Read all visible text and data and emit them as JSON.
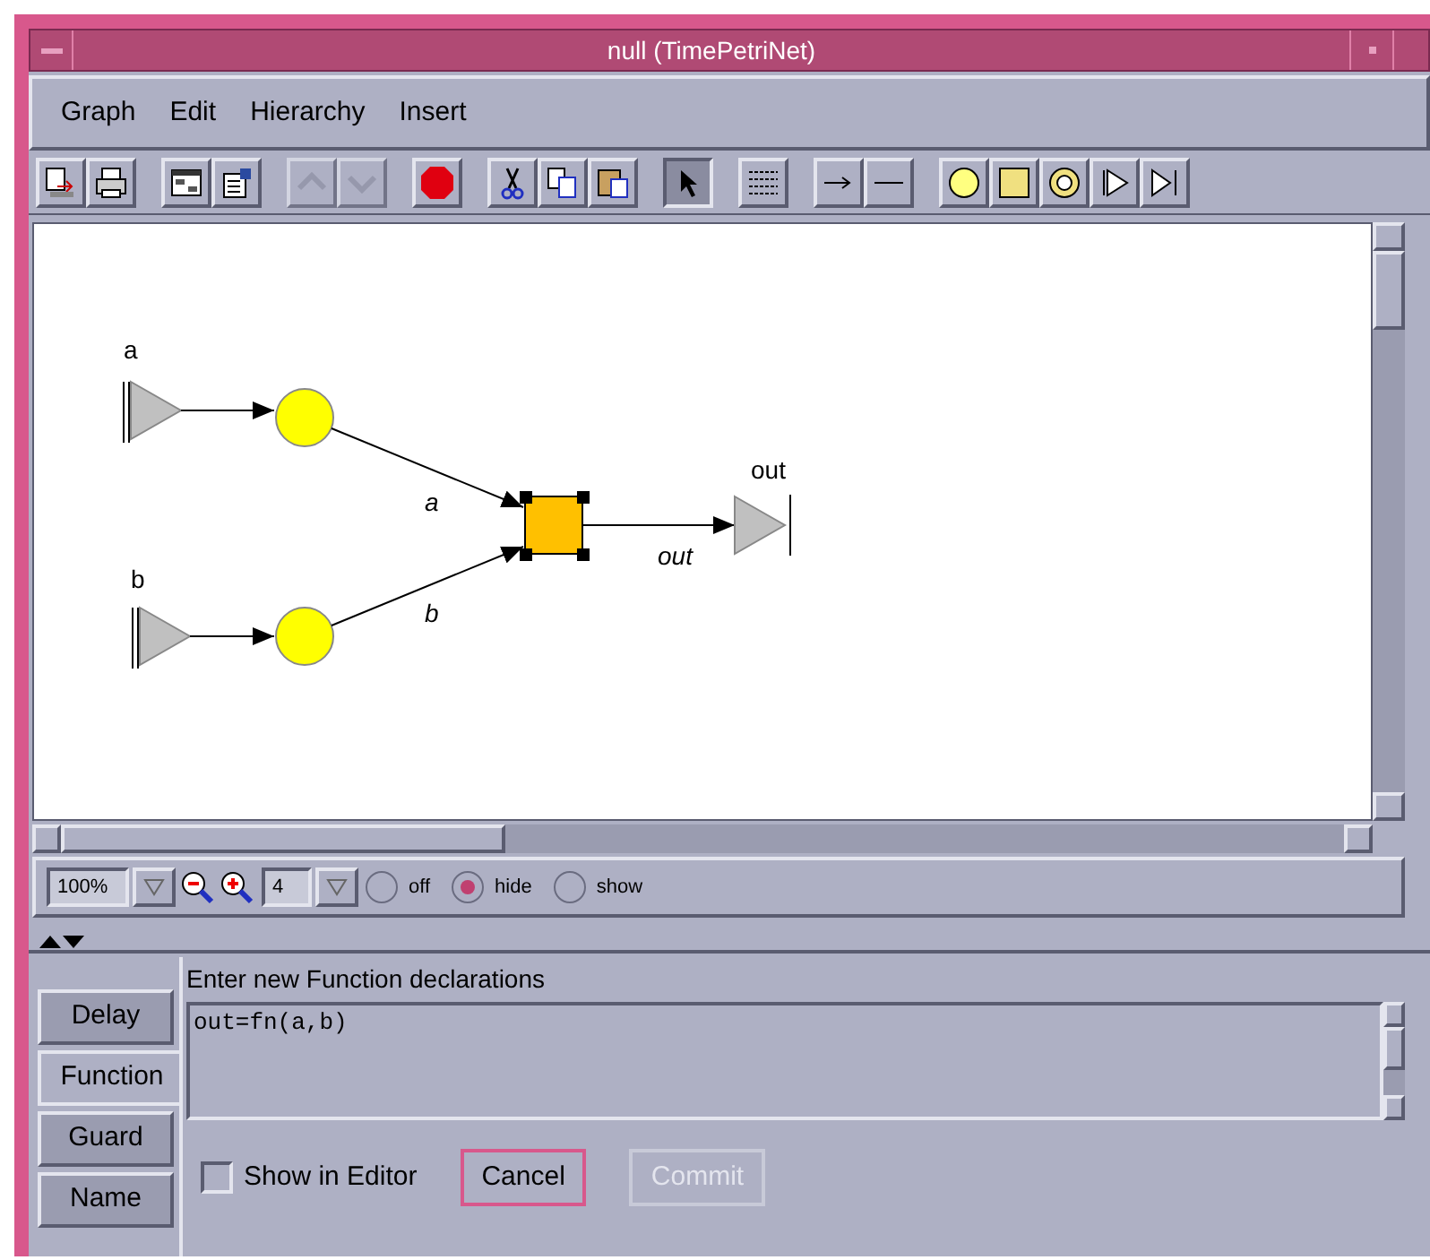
{
  "window": {
    "title": "null (TimePetriNet)"
  },
  "menu": [
    "Graph",
    "Edit",
    "Hierarchy",
    "Insert"
  ],
  "toolbar": [
    {
      "kind": "import",
      "selected": false,
      "disabled": false
    },
    {
      "kind": "print",
      "selected": false,
      "disabled": false
    },
    {
      "kind": "layout",
      "selected": false,
      "disabled": false
    },
    {
      "kind": "properties",
      "selected": false,
      "disabled": false
    },
    {
      "kind": "up",
      "selected": false,
      "disabled": true
    },
    {
      "kind": "down",
      "selected": false,
      "disabled": true
    },
    {
      "kind": "stop",
      "selected": false,
      "disabled": false
    },
    {
      "kind": "cut",
      "selected": false,
      "disabled": false
    },
    {
      "kind": "copy",
      "selected": false,
      "disabled": false
    },
    {
      "kind": "paste",
      "selected": false,
      "disabled": false
    },
    {
      "kind": "pointer",
      "selected": true,
      "disabled": false
    },
    {
      "kind": "text",
      "selected": false,
      "disabled": false
    },
    {
      "kind": "arc",
      "selected": false,
      "disabled": false
    },
    {
      "kind": "line",
      "selected": false,
      "disabled": false
    },
    {
      "kind": "place",
      "selected": false,
      "disabled": false
    },
    {
      "kind": "transition",
      "selected": false,
      "disabled": false
    },
    {
      "kind": "ring",
      "selected": false,
      "disabled": false
    },
    {
      "kind": "port_in",
      "selected": false,
      "disabled": false
    },
    {
      "kind": "port_out",
      "selected": false,
      "disabled": false
    }
  ],
  "canvas": {
    "input_ports": [
      "a",
      "b"
    ],
    "output_port": "out",
    "arc_labels": [
      "a",
      "b",
      "out"
    ],
    "transition_selected": true
  },
  "zoom_bar": {
    "zoom": "100%",
    "grid": "4",
    "radios": [
      {
        "label": "off",
        "selected": false
      },
      {
        "label": "hide",
        "selected": true
      },
      {
        "label": "show",
        "selected": false
      }
    ]
  },
  "editor": {
    "tabs": [
      {
        "label": "Delay",
        "selected": false
      },
      {
        "label": "Function",
        "selected": true
      },
      {
        "label": "Guard",
        "selected": false
      },
      {
        "label": "Name",
        "selected": false
      }
    ],
    "heading": "Enter new Function declarations",
    "value": "out=fn(a,b)",
    "show_in_editor": {
      "label": "Show in Editor",
      "checked": false
    },
    "buttons": [
      {
        "label": "Cancel",
        "disabled": false
      },
      {
        "label": "Commit",
        "disabled": true
      }
    ]
  }
}
